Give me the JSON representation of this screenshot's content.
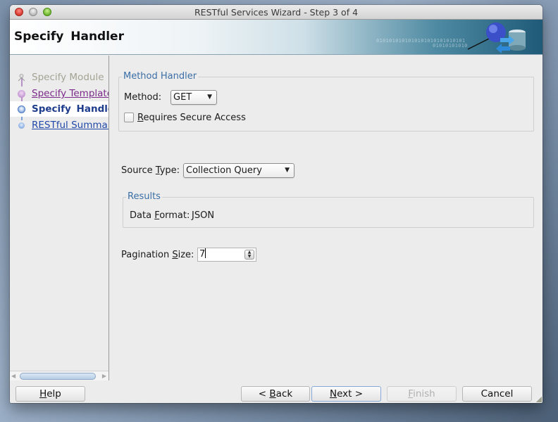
{
  "window": {
    "title": "RESTful Services Wizard - Step 3 of 4"
  },
  "header": {
    "title": "Specify  Handler",
    "binary_text_1": "0101010101010101010101010101",
    "binary_text_2": "01010101010"
  },
  "sidebar": {
    "steps": [
      {
        "label": "Specify Module",
        "state": "completed"
      },
      {
        "label": "Specify Template",
        "state": "visited"
      },
      {
        "label": "Specify  Handler",
        "state": "current"
      },
      {
        "label": "RESTful Summary",
        "state": "next"
      }
    ]
  },
  "method_handler": {
    "legend": "Method Handler",
    "method_label": "Method:",
    "method_value": "GET",
    "secure_label_mnemonic": "R",
    "secure_label_rest": "equires Secure Access",
    "secure_checked": false
  },
  "source_type": {
    "label_prefix": "Source ",
    "label_mnemonic": "T",
    "label_suffix": "ype:",
    "value": "Collection Query"
  },
  "results": {
    "legend": "Results",
    "data_format_prefix": "Data ",
    "data_format_mnemonic": "F",
    "data_format_suffix": "ormat:",
    "data_format_value": "JSON"
  },
  "pagination": {
    "label_prefix": "Pagination ",
    "label_mnemonic": "S",
    "label_suffix": "ize:",
    "value": "7"
  },
  "buttons": {
    "help_mnemonic": "H",
    "help_rest": "elp",
    "back_prefix": "< ",
    "back_mnemonic": "B",
    "back_rest": "ack",
    "next_mnemonic": "N",
    "next_rest": "ext >",
    "finish_mnemonic": "F",
    "finish_rest": "inish",
    "finish_enabled": false,
    "cancel": "Cancel"
  }
}
